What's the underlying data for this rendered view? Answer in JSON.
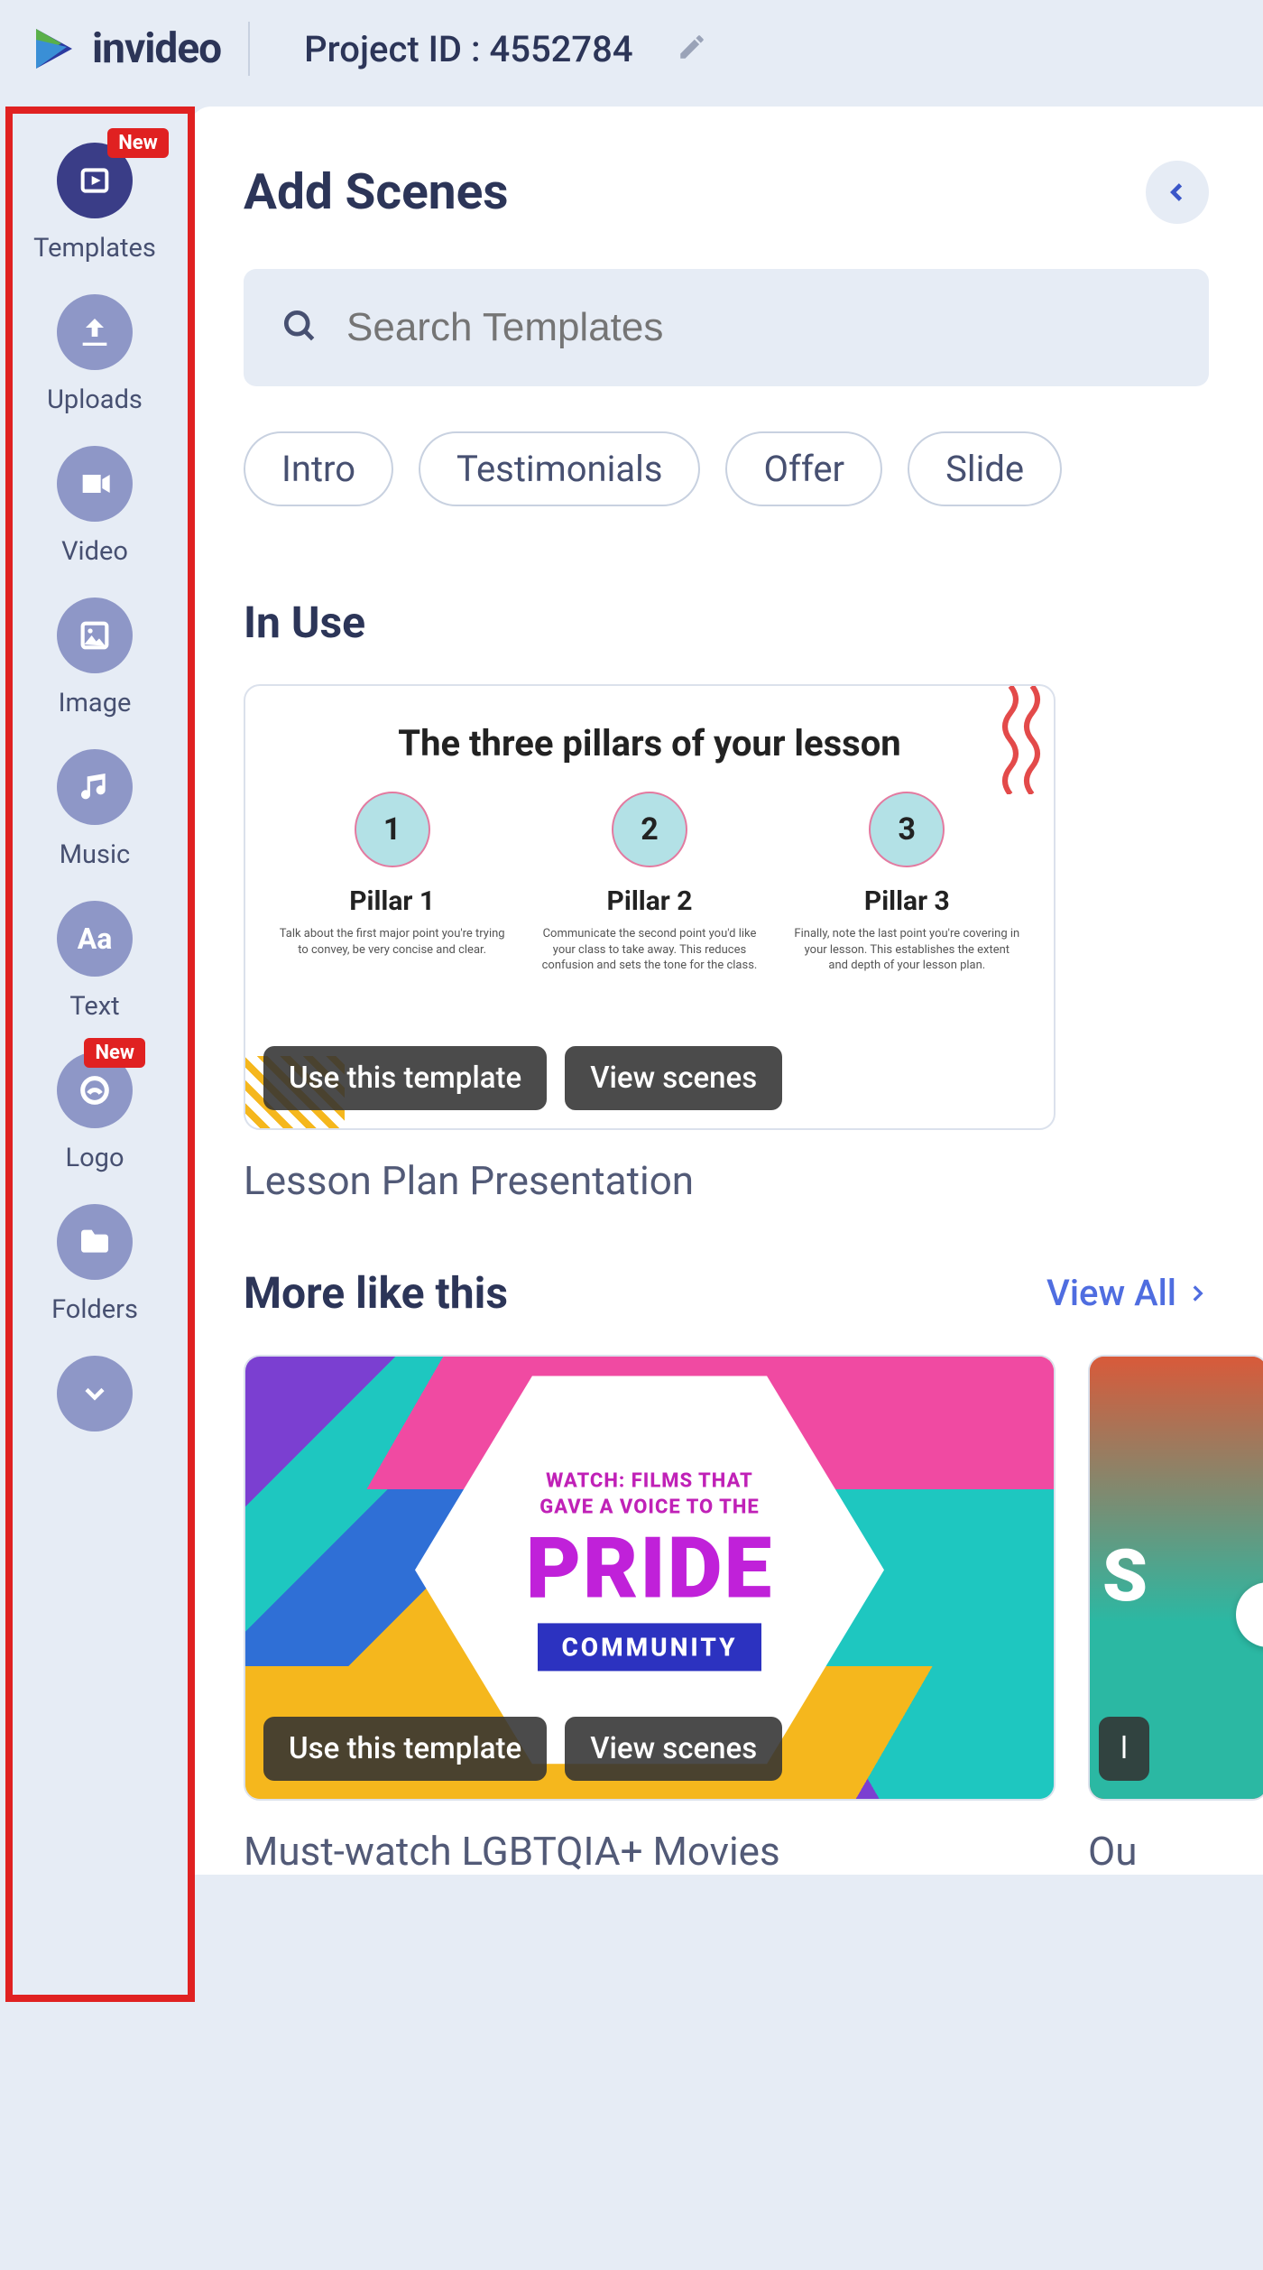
{
  "topbar": {
    "brand": "invideo",
    "project_label": "Project ID : 4552784"
  },
  "sidebar": {
    "new_badge": "New",
    "items": [
      {
        "label": "Templates",
        "active": true,
        "new": true
      },
      {
        "label": "Uploads"
      },
      {
        "label": "Video"
      },
      {
        "label": "Image"
      },
      {
        "label": "Music"
      },
      {
        "label": "Text"
      },
      {
        "label": "Logo",
        "new": true
      },
      {
        "label": "Folders"
      }
    ]
  },
  "panel": {
    "title": "Add Scenes",
    "search_placeholder": "Search Templates",
    "chips": [
      "Intro",
      "Testimonials",
      "Offer",
      "Slide"
    ],
    "sections": {
      "in_use": {
        "title": "In Use",
        "card": {
          "title": "Lesson Plan Presentation",
          "thumb": {
            "heading": "The three pillars of your lesson",
            "pillars": [
              {
                "num": "1",
                "name": "Pillar 1",
                "desc": "Talk about the first major point you're trying to convey, be very concise and clear."
              },
              {
                "num": "2",
                "name": "Pillar 2",
                "desc": "Communicate the second point you'd like your class to take away. This reduces confusion and sets the tone for the class."
              },
              {
                "num": "3",
                "name": "Pillar 3",
                "desc": "Finally, note the last point you're covering in your lesson. This establishes the extent and depth of your lesson plan."
              }
            ]
          },
          "actions": {
            "use": "Use this template",
            "view": "View scenes"
          }
        }
      },
      "more": {
        "title": "More like this",
        "view_all": "View All",
        "cards": [
          {
            "title": "Must-watch LGBTQIA+ Movies",
            "thumb": {
              "line1": "WATCH: FILMS THAT",
              "line2": "GAVE A VOICE TO THE",
              "word": "PRIDE",
              "tag": "COMMUNITY"
            },
            "actions": {
              "use": "Use this template",
              "view": "View scenes"
            }
          },
          {
            "title_partial": "Ou"
          }
        ]
      }
    }
  }
}
